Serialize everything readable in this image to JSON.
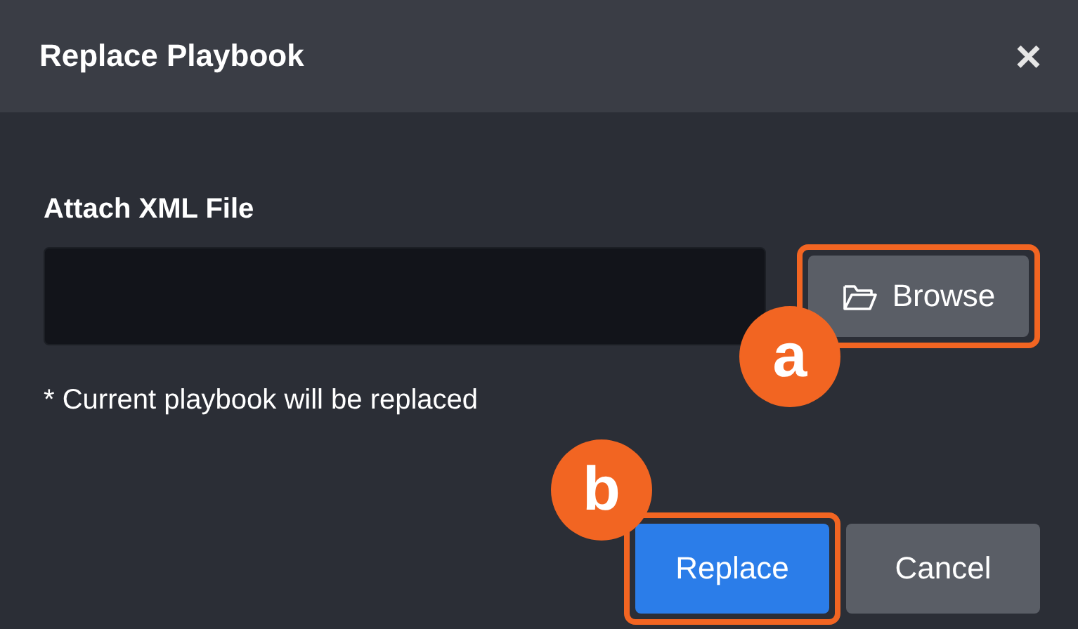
{
  "dialog": {
    "title": "Replace Playbook",
    "close": "×"
  },
  "field": {
    "label": "Attach XML File",
    "browse": "Browse",
    "note": "* Current playbook will be replaced"
  },
  "buttons": [
    {
      "label": "Replace",
      "kind": "primary",
      "callout": "b"
    },
    {
      "label": "Cancel",
      "kind": "secondary"
    }
  ],
  "browse_callout": "a"
}
